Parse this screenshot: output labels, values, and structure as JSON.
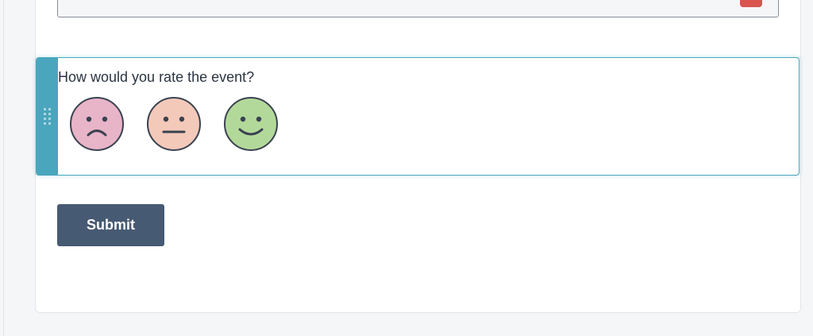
{
  "question": {
    "text": "How would you rate the event?"
  },
  "rating_options": [
    {
      "name": "sad-face-icon",
      "fill": "#e8b4c8"
    },
    {
      "name": "neutral-face-icon",
      "fill": "#f3c9ba"
    },
    {
      "name": "happy-face-icon",
      "fill": "#b3d99a"
    }
  ],
  "submit": {
    "label": "Submit"
  },
  "colors": {
    "accent": "#4aa6bd",
    "button": "#475a73",
    "error_badge": "#d9544f"
  }
}
